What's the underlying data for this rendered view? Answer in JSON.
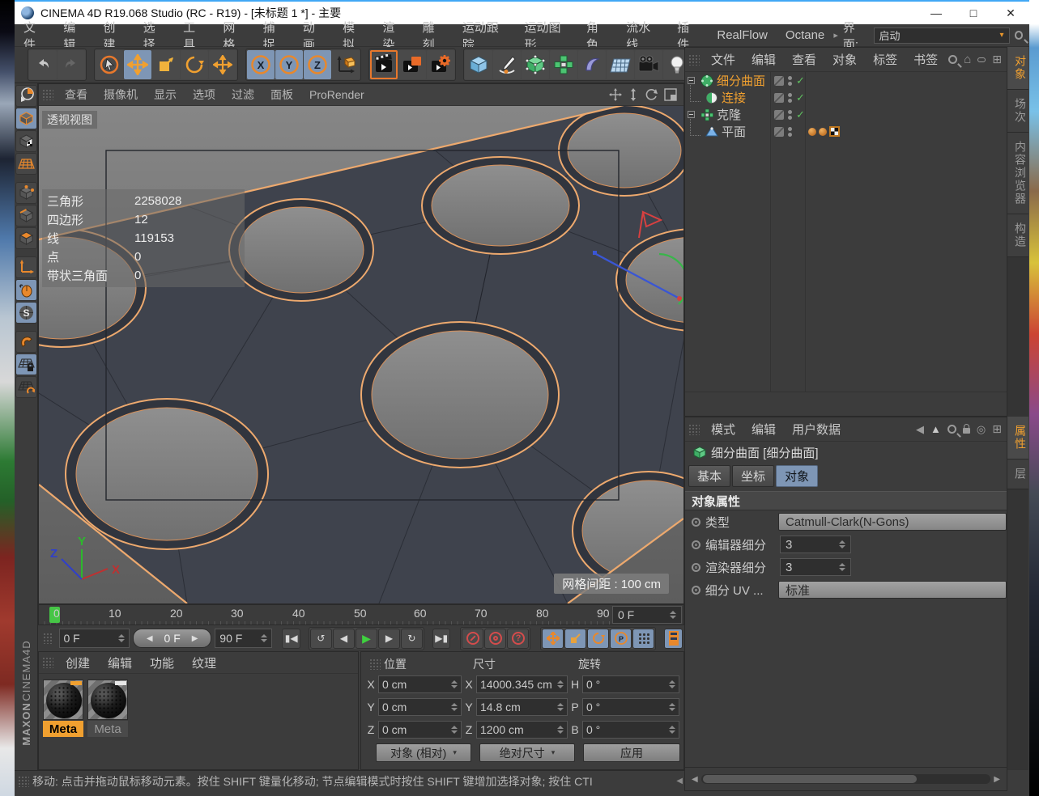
{
  "window": {
    "title": "CINEMA 4D R19.068 Studio (RC - R19) - [未标题 1 *] - 主要",
    "minimize": "—",
    "maximize": "□",
    "close": "✕"
  },
  "menubar": {
    "items": [
      "文件",
      "编辑",
      "创建",
      "选择",
      "工具",
      "网格",
      "捕捉",
      "动画",
      "模拟",
      "渲染",
      "雕刻",
      "运动跟踪",
      "运动图形",
      "角色",
      "流水线",
      "插件",
      "RealFlow",
      "Octane"
    ],
    "interface_chevron": "▸",
    "interface_label": "界面:",
    "interface_value": "启动",
    "dropdown_arrow": "▾"
  },
  "viewport": {
    "menu": [
      "查看",
      "摄像机",
      "显示",
      "选项",
      "过滤",
      "面板",
      "ProRender"
    ],
    "view_label": "透视视图",
    "grid_label": "网格间距 : 100 cm",
    "stats": [
      {
        "label": "三角形",
        "value": "2258028"
      },
      {
        "label": "四边形",
        "value": "12"
      },
      {
        "label": "线",
        "value": "119153"
      },
      {
        "label": "点",
        "value": "0"
      },
      {
        "label": "带状三角面",
        "value": "0"
      }
    ],
    "axis": {
      "x": "X",
      "y": "Y",
      "z": "Z"
    }
  },
  "timeline": {
    "ticks": [
      "0",
      "10",
      "20",
      "30",
      "40",
      "50",
      "60",
      "70",
      "80",
      "90"
    ],
    "current": "0 F"
  },
  "transport": {
    "start": "0 F",
    "scrub": "0 F",
    "end": "90 F",
    "scrub_left": "◀",
    "scrub_right": "▶",
    "go_start": "▮◀",
    "loop_back": "↺",
    "prev": "◀",
    "play": "▶",
    "next": "▶",
    "loop_fwd": "↻",
    "go_end": "▶▮",
    "question": "?",
    "p_label": "P"
  },
  "materials": {
    "menu": [
      "创建",
      "编辑",
      "功能",
      "纹理"
    ],
    "items": [
      {
        "name": "Meta"
      },
      {
        "name": "Meta"
      }
    ]
  },
  "coordinates": {
    "pos_title": "位置",
    "size_title": "尺寸",
    "rot_title": "旋转",
    "pos": [
      {
        "axis": "X",
        "value": "0 cm"
      },
      {
        "axis": "Y",
        "value": "0 cm"
      },
      {
        "axis": "Z",
        "value": "0 cm"
      }
    ],
    "size": [
      {
        "axis": "X",
        "value": "14000.345 cm"
      },
      {
        "axis": "Y",
        "value": "14.8 cm"
      },
      {
        "axis": "Z",
        "value": "1200 cm"
      }
    ],
    "rot": [
      {
        "axis": "H",
        "value": "0 °"
      },
      {
        "axis": "P",
        "value": "0 °"
      },
      {
        "axis": "B",
        "value": "0 °"
      }
    ],
    "pos_mode": "对象 (相对)",
    "size_mode": "绝对尺寸",
    "apply": "应用",
    "dd_arrow": "▾"
  },
  "statusbar": {
    "text": "移动: 点击并拖动鼠标移动元素。按住 SHIFT 键量化移动; 节点编辑模式时按住 SHIFT 键增加选择对象; 按住 CTI",
    "arrow": "◀"
  },
  "object_manager": {
    "menu": [
      "文件",
      "编辑",
      "查看",
      "对象",
      "标签",
      "书签"
    ],
    "items": [
      {
        "label": "细分曲面"
      },
      {
        "label": "连接"
      },
      {
        "label": "克隆"
      },
      {
        "label": "平面"
      }
    ],
    "check": "✓",
    "plus": "⊞",
    "home": "⌂"
  },
  "right_tabs_top": [
    "对象",
    "场次",
    "内容浏览器",
    "构造"
  ],
  "right_tabs_bottom": [
    "属性",
    "层"
  ],
  "attribute_manager": {
    "menu": [
      "模式",
      "编辑",
      "用户数据"
    ],
    "back": "◀",
    "fwd": "▲",
    "target": "◎",
    "plus": "⊞",
    "object_title": "细分曲面 [细分曲面]",
    "tabs": [
      "基本",
      "坐标",
      "对象"
    ],
    "section": "对象属性",
    "rows": [
      {
        "label": "类型",
        "value": "Catmull-Clark(N-Gons)"
      },
      {
        "label": "编辑器细分",
        "value": "3"
      },
      {
        "label": "渲染器细分",
        "value": "3"
      },
      {
        "label": "细分 UV ...",
        "value": "标准"
      }
    ]
  },
  "branding": {
    "maxon": "MAXON",
    "cinema": "CINEMA4D"
  }
}
